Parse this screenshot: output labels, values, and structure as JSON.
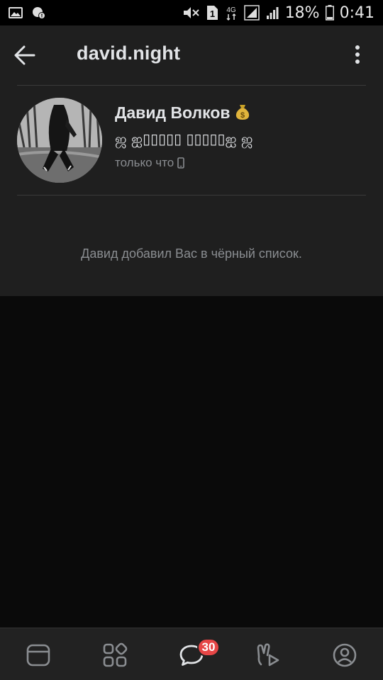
{
  "status_bar": {
    "battery_percent": "18%",
    "time": "0:41",
    "network": "4G",
    "sim": "1"
  },
  "header": {
    "title": "david.night"
  },
  "profile": {
    "name": "Давид Волков",
    "emoji": "💰",
    "status": "ஜ ஐ▯▯▯▯▯ ▯▯▯▯▯ஐ ஜ",
    "last_seen": "только что"
  },
  "notice": "Давид добавил Вас в чёрный список.",
  "bottom_nav": {
    "items": [
      "feed-icon",
      "services-icon",
      "messages-icon",
      "clips-icon",
      "profile-icon"
    ],
    "messages_badge": "30"
  },
  "colors": {
    "panel_bg": "#1f1f1f",
    "page_bg": "#0a0a0a",
    "badge_red": "#e64646",
    "secondary_text": "#8a8d91"
  }
}
